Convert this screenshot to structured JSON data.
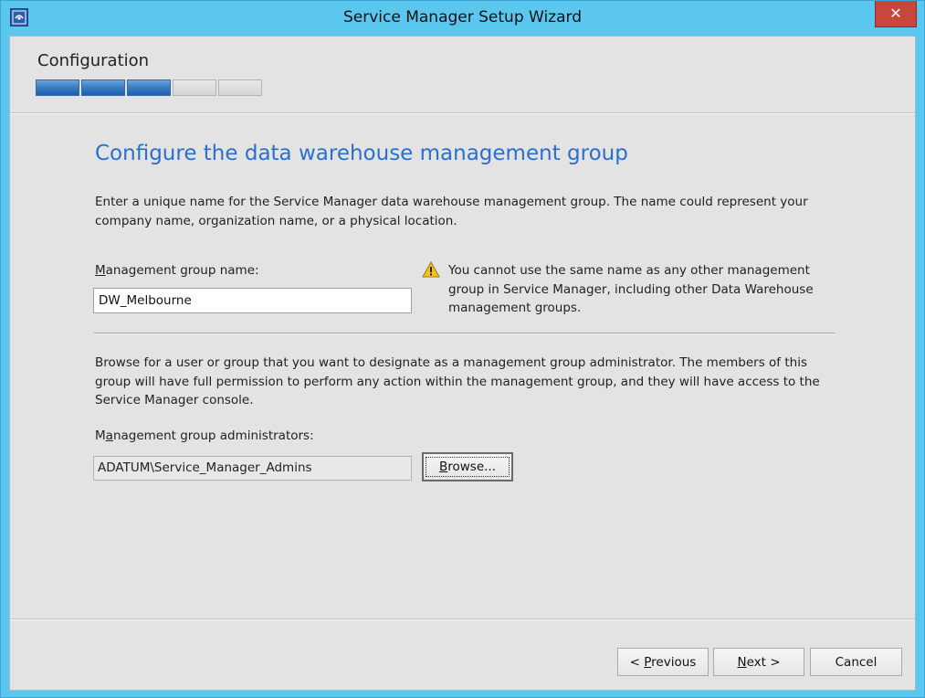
{
  "window": {
    "title": "Service Manager Setup Wizard",
    "close_symbol": "✕",
    "accent_color": "#5cc7ee",
    "icon": "service-manager-app-icon"
  },
  "stage": {
    "title": "Configuration",
    "progress": {
      "completed_segments": 3,
      "total_segments": 5
    }
  },
  "page": {
    "heading": "Configure the data warehouse management group",
    "heading_color": "#2a6fcf",
    "intro": "Enter a unique name for the Service Manager data warehouse management group. The name could represent your company name, organization name, or a physical location."
  },
  "group_name": {
    "label_access_key": "M",
    "label_rest": "anagement group name:",
    "value": "DW_Melbourne"
  },
  "warning": {
    "icon": "warning-triangle-icon",
    "text": "You cannot use the same name as any other management group in Service Manager, including other Data Warehouse management groups."
  },
  "admins": {
    "description": "Browse for a user or group that you want to designate as a management group administrator. The members of this group will have full permission to perform any action within the management group, and they will have access to the Service Manager console.",
    "label_pre": "M",
    "label_access_key": "a",
    "label_rest": "nagement group administrators:",
    "value": "ADATUM\\Service_Manager_Admins",
    "browse_access_key": "B",
    "browse_rest": "rowse..."
  },
  "footer": {
    "previous_pre": "< ",
    "previous_access_key": "P",
    "previous_rest": "revious",
    "next_access_key": "N",
    "next_rest": "ext >",
    "cancel_label": "Cancel"
  }
}
